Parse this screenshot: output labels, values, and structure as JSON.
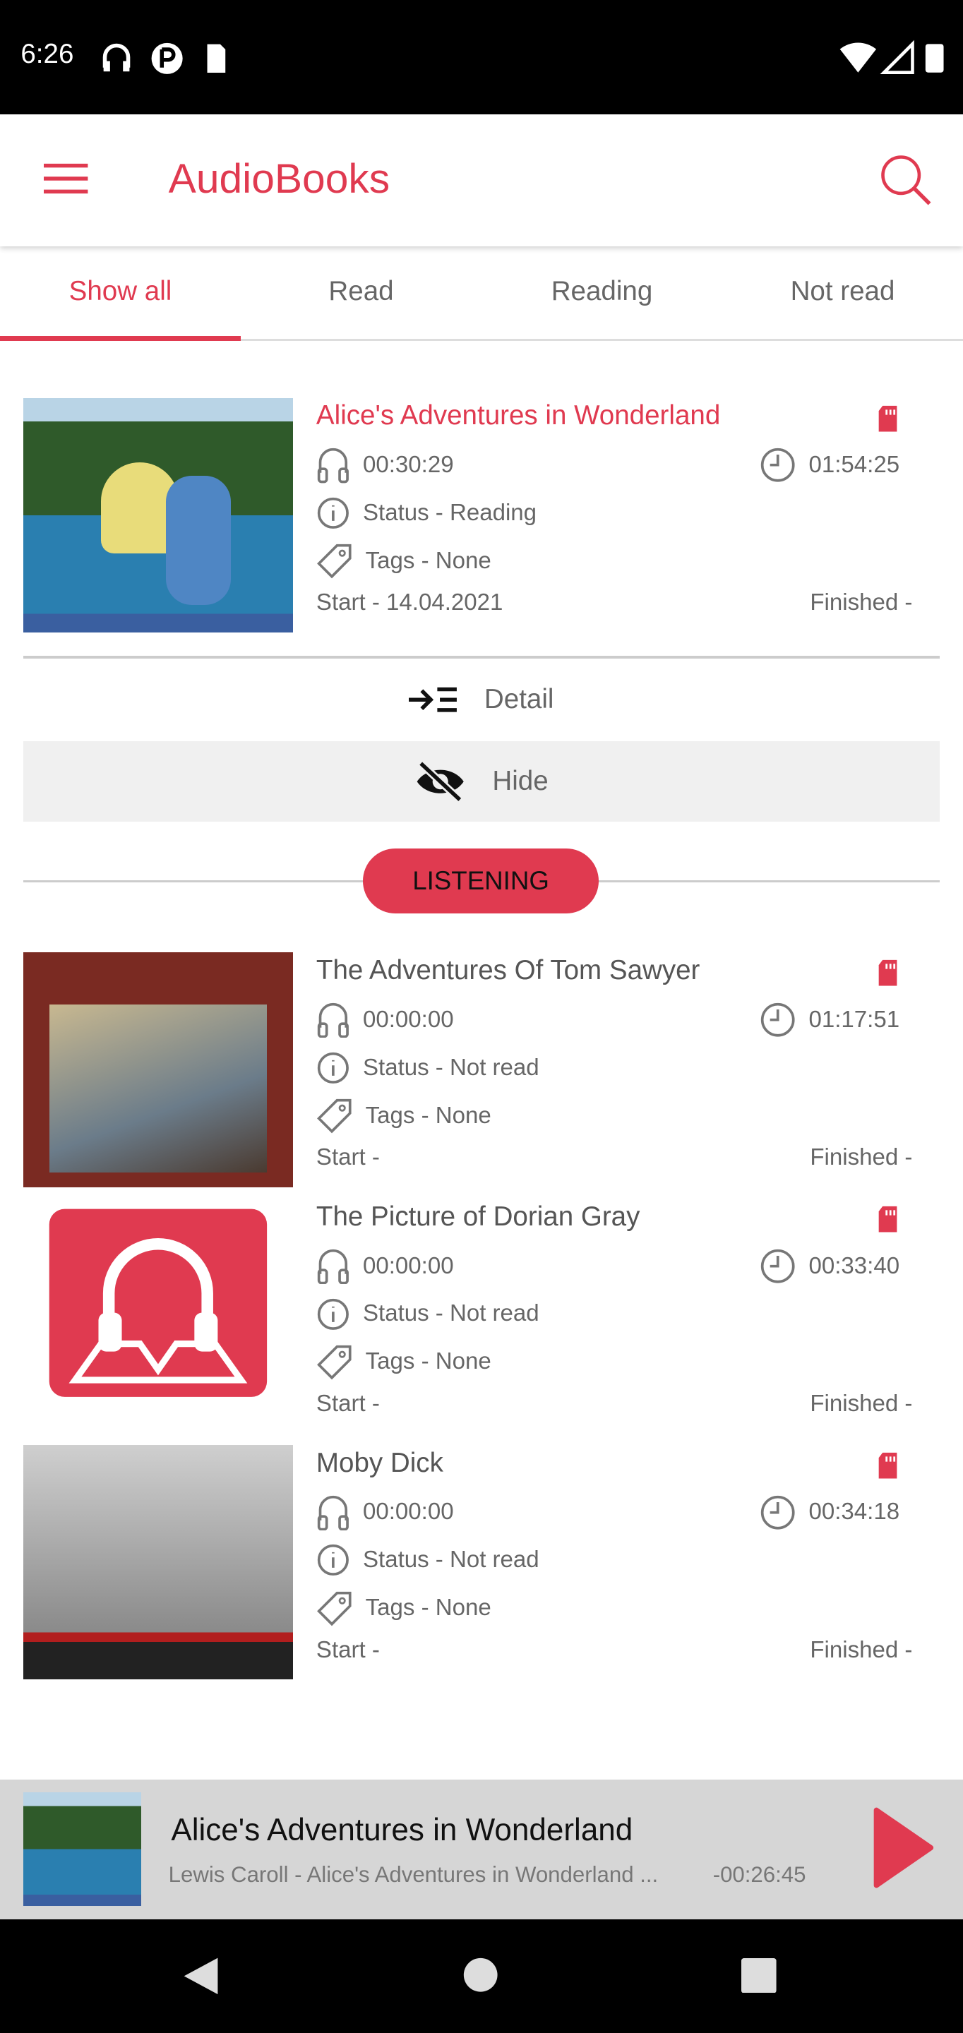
{
  "status_bar": {
    "time": "6:26",
    "icons": [
      "headphones-icon",
      "p-icon",
      "sd-card-icon",
      "wifi-icon",
      "signal-icon",
      "battery-icon"
    ]
  },
  "app_bar": {
    "title": "AudioBooks",
    "menu_icon": "menu-icon",
    "search_icon": "search-icon"
  },
  "tabs": [
    {
      "label": "Show all",
      "active": true
    },
    {
      "label": "Read"
    },
    {
      "label": "Reading"
    },
    {
      "label": "Not read"
    }
  ],
  "current_book": {
    "title": "Alice's Adventures in Wonderland",
    "listened": "00:30:29",
    "duration": "01:54:25",
    "status": "Status - Reading",
    "tags": "Tags - None",
    "start": "Start - 14.04.2021",
    "finished": "Finished -"
  },
  "actions": {
    "detail": "Detail",
    "hide": "Hide"
  },
  "section_label": "LISTENING",
  "books": [
    {
      "title": "The Adventures Of Tom Sawyer",
      "listened": "00:00:00",
      "duration": "01:17:51",
      "status": "Status - Not read",
      "tags": "Tags - None",
      "start": "Start -",
      "finished": "Finished -"
    },
    {
      "title": "The Picture of Dorian Gray",
      "listened": "00:00:00",
      "duration": "00:33:40",
      "status": "Status - Not read",
      "tags": "Tags - None",
      "start": "Start -",
      "finished": "Finished -"
    },
    {
      "title": "Moby Dick",
      "listened": "00:00:00",
      "duration": "00:34:18",
      "status": "Status - Not read",
      "tags": "Tags - None",
      "start": "Start -",
      "finished": "Finished -"
    }
  ],
  "mini_player": {
    "title": "Alice's Adventures in Wonderland",
    "subtitle": "Lewis Caroll - Alice's Adventures in Wonderland ...",
    "remaining": "-00:26:45",
    "play_icon": "play-icon"
  },
  "colors": {
    "accent": "#e03a50",
    "mini_player_bg": "#d6d6d6",
    "hide_row_bg": "#f0f0f0"
  }
}
